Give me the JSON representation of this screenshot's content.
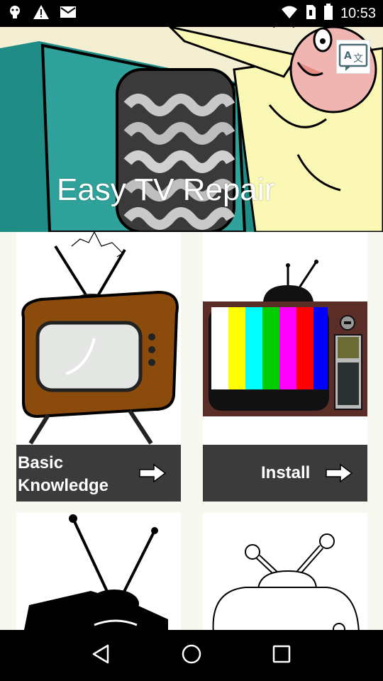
{
  "status_bar": {
    "time": "10:53",
    "icons": [
      "android-debug-icon",
      "warning-icon",
      "gmail-icon",
      "wifi-icon",
      "sim-icon",
      "battery-icon"
    ]
  },
  "hero": {
    "title": "Easy TV Repair",
    "translate_icon": "translate-icon"
  },
  "cards": [
    {
      "label": "Basic\nKnowledge",
      "label_line1": "Basic",
      "label_line2": "Knowledge",
      "icon": "arrow-right-icon"
    },
    {
      "label": "Install",
      "icon": "arrow-right-icon"
    }
  ],
  "nav_bar": {
    "icons": [
      "back-icon",
      "home-icon",
      "recents-icon"
    ]
  },
  "colors": {
    "card_bar": "#3b3b3b",
    "background": "#f7f8ef"
  }
}
